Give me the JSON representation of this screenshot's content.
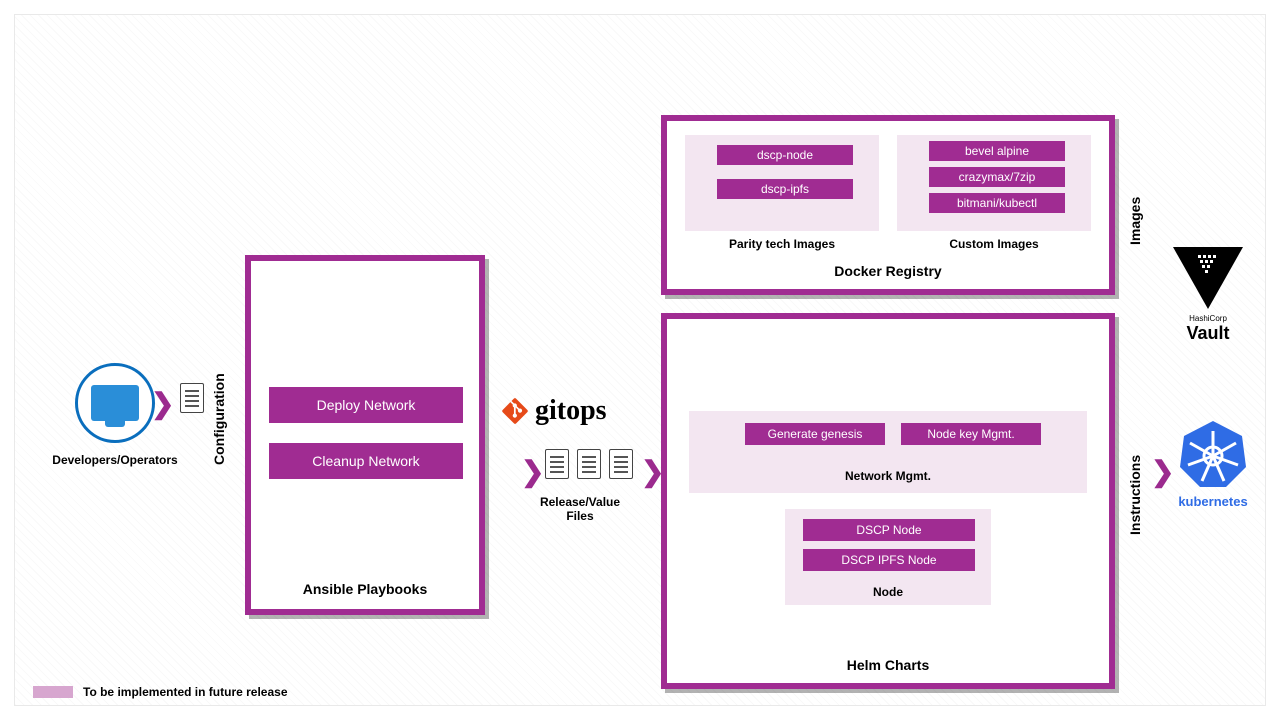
{
  "developers": {
    "label": "Developers/Operators"
  },
  "sidebar": {
    "configuration": "Configuration",
    "images": "Images",
    "instructions": "Instructions"
  },
  "ansible": {
    "title": "Ansible Playbooks",
    "deploy": "Deploy Network",
    "cleanup": "Cleanup Network"
  },
  "gitops": {
    "logo_text": "gitops",
    "files_caption": "Release/Value\nFiles"
  },
  "docker": {
    "title": "Docker Registry",
    "parity": {
      "caption": "Parity tech Images",
      "images": [
        "dscp-node",
        "dscp-ipfs"
      ]
    },
    "custom": {
      "caption": "Custom Images",
      "images": [
        "bevel alpine",
        "crazymax/7zip",
        "bitmani/kubectl"
      ]
    }
  },
  "helm": {
    "title": "Helm Charts",
    "netmgmt": {
      "caption": "Network Mgmt.",
      "items": [
        "Generate genesis",
        "Node key Mgmt."
      ]
    },
    "node": {
      "caption": "Node",
      "items": [
        "DSCP Node",
        "DSCP IPFS Node"
      ]
    }
  },
  "external": {
    "vault_top": "HashiCorp",
    "vault": "Vault",
    "kubernetes": "kubernetes"
  },
  "legend": {
    "text": "To be implemented in future release"
  }
}
